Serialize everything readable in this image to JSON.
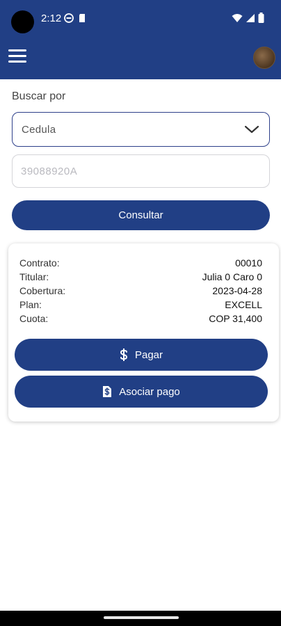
{
  "status_bar": {
    "time": "2:12"
  },
  "app_bar": {
    "menu_icon": "hamburger-menu-icon",
    "avatar": "user-avatar"
  },
  "search": {
    "label": "Buscar por",
    "type_selected": "Cedula",
    "id_placeholder": "39088920A",
    "consult_label": "Consultar"
  },
  "result_card": {
    "rows": [
      {
        "label": "Contrato:",
        "value": "00010"
      },
      {
        "label": "Titular:",
        "value": "Julia 0 Caro 0"
      },
      {
        "label": "Cobertura:",
        "value": "2023-04-28"
      },
      {
        "label": "Plan:",
        "value": "EXCELL"
      },
      {
        "label": "Cuota:",
        "value": "COP 31,400"
      }
    ],
    "pay_label": "Pagar",
    "associate_label": "Asociar pago"
  },
  "colors": {
    "primary": "#213f85",
    "background": "#ffffff"
  }
}
